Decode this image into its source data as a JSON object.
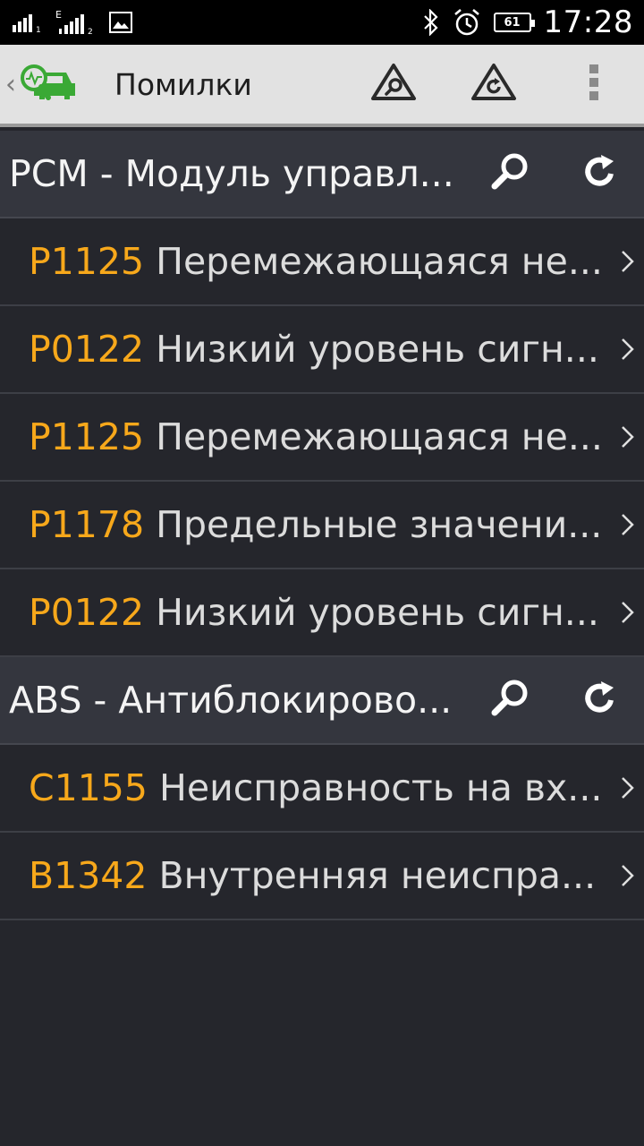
{
  "status_bar": {
    "time": "17:28",
    "battery": "61",
    "network_label": "E"
  },
  "action_bar": {
    "title": "Помилки"
  },
  "sections": [
    {
      "title": "PCM - Модуль управл...",
      "items": [
        {
          "code": "P1125",
          "text": "Перемежающаяся не..."
        },
        {
          "code": "P0122",
          "text": "Низкий уровень сигн..."
        },
        {
          "code": "P1125",
          "text": "Перемежающаяся не..."
        },
        {
          "code": "P1178",
          "text": "Предельные значени..."
        },
        {
          "code": "P0122",
          "text": "Низкий уровень сигн..."
        }
      ]
    },
    {
      "title": "ABS - Антиблокирово...",
      "items": [
        {
          "code": "C1155",
          "text": "Неисправность на вх..."
        },
        {
          "code": "B1342",
          "text": "Внутренняя неиспра..."
        }
      ]
    }
  ],
  "colors": {
    "background": "#25262c",
    "section_header": "#34363e",
    "action_bar": "#e2e2e2",
    "code_accent": "#f7a81b",
    "logo_green": "#3aa935"
  },
  "icons": {
    "search": "search-icon",
    "refresh": "refresh-icon",
    "chevron": "chevron-right-icon",
    "menu": "overflow-menu-icon"
  }
}
